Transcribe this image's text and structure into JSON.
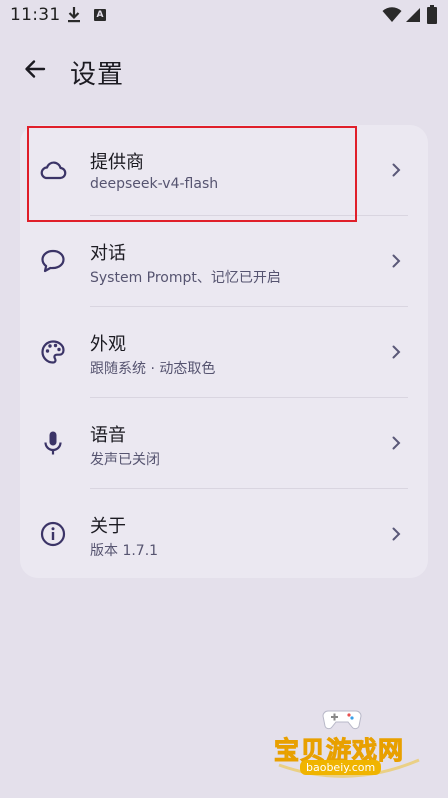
{
  "status_bar": {
    "time": "11:31",
    "notification_badge": "A",
    "icons": [
      "download-icon",
      "wifi-icon",
      "signal-icon",
      "battery-icon"
    ]
  },
  "header": {
    "back_icon": "arrow-left-icon",
    "title": "设置"
  },
  "settings": {
    "items": [
      {
        "icon": "cloud-icon",
        "title": "提供商",
        "subtitle": "deepseek-v4-flash"
      },
      {
        "icon": "chat-bubble-icon",
        "title": "对话",
        "subtitle": "System Prompt、记忆已开启"
      },
      {
        "icon": "palette-icon",
        "title": "外观",
        "subtitle": "跟随系统 · 动态取色"
      },
      {
        "icon": "microphone-icon",
        "title": "语音",
        "subtitle": "发声已关闭"
      },
      {
        "icon": "info-icon",
        "title": "关于",
        "subtitle": "版本 1.7.1"
      }
    ]
  },
  "watermark": {
    "title": "宝贝游戏网",
    "url": "baobeiy.com"
  },
  "colors": {
    "background": "#e4e0eb",
    "card": "#ebe8f1",
    "icon": "#3b3467",
    "highlight": "#e01f2a",
    "subtitle": "#565470"
  }
}
